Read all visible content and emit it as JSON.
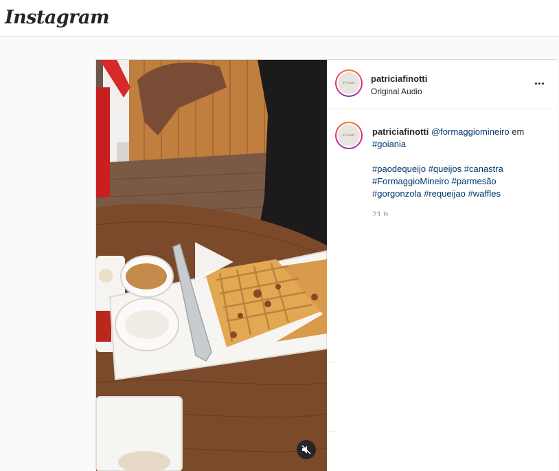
{
  "app": {
    "logo_text": "Instagram"
  },
  "post": {
    "author": {
      "username": "patriciafinotti",
      "audio": "Original Audio",
      "avatar_text": "Finotti"
    },
    "caption": {
      "username": "patriciafinotti",
      "mention": "@formaggiomineiro",
      "connector": " em",
      "location_tag": "#goiania",
      "hashtags": [
        "#paodequeijo",
        "#queijos",
        "#canastra",
        "#FormaggioMineiro",
        "#parmesão",
        "#gorgonzola",
        "#requeijao",
        "#waffles"
      ]
    },
    "time": "21 h",
    "media": {
      "type": "video",
      "play_icon": "play-icon",
      "mute_icon": "speaker-muted-icon"
    }
  },
  "colors": {
    "link": "#00376b",
    "text": "#262626",
    "border": "#dbdbdb"
  }
}
